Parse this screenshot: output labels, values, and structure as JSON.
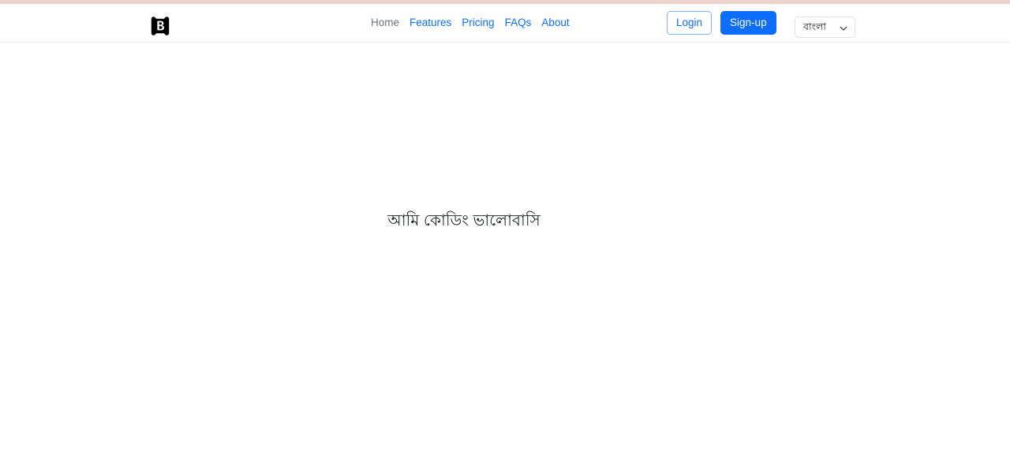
{
  "theme": {
    "accent_strip_color": "#eed4cb",
    "primary_color": "#0d6efd",
    "muted_color": "#6c757d",
    "border_color": "#dee2e6",
    "text_color": "#212529",
    "background_color": "#ffffff"
  },
  "navbar": {
    "brand": {
      "icon": "bootstrap-b-logo",
      "letter": "B"
    },
    "links": [
      {
        "label": "Home",
        "style": "muted"
      },
      {
        "label": "Features",
        "style": "link"
      },
      {
        "label": "Pricing",
        "style": "link"
      },
      {
        "label": "FAQs",
        "style": "link"
      },
      {
        "label": "About",
        "style": "link"
      }
    ],
    "auth": {
      "login_label": "Login",
      "signup_label": "Sign-up"
    },
    "language_select": {
      "selected": "বাংলা",
      "chevron_icon": "chevron-down-icon",
      "options": [
        "বাংলা"
      ]
    }
  },
  "main": {
    "hero_text": "আমি কোডিং ভালোবাসি"
  }
}
